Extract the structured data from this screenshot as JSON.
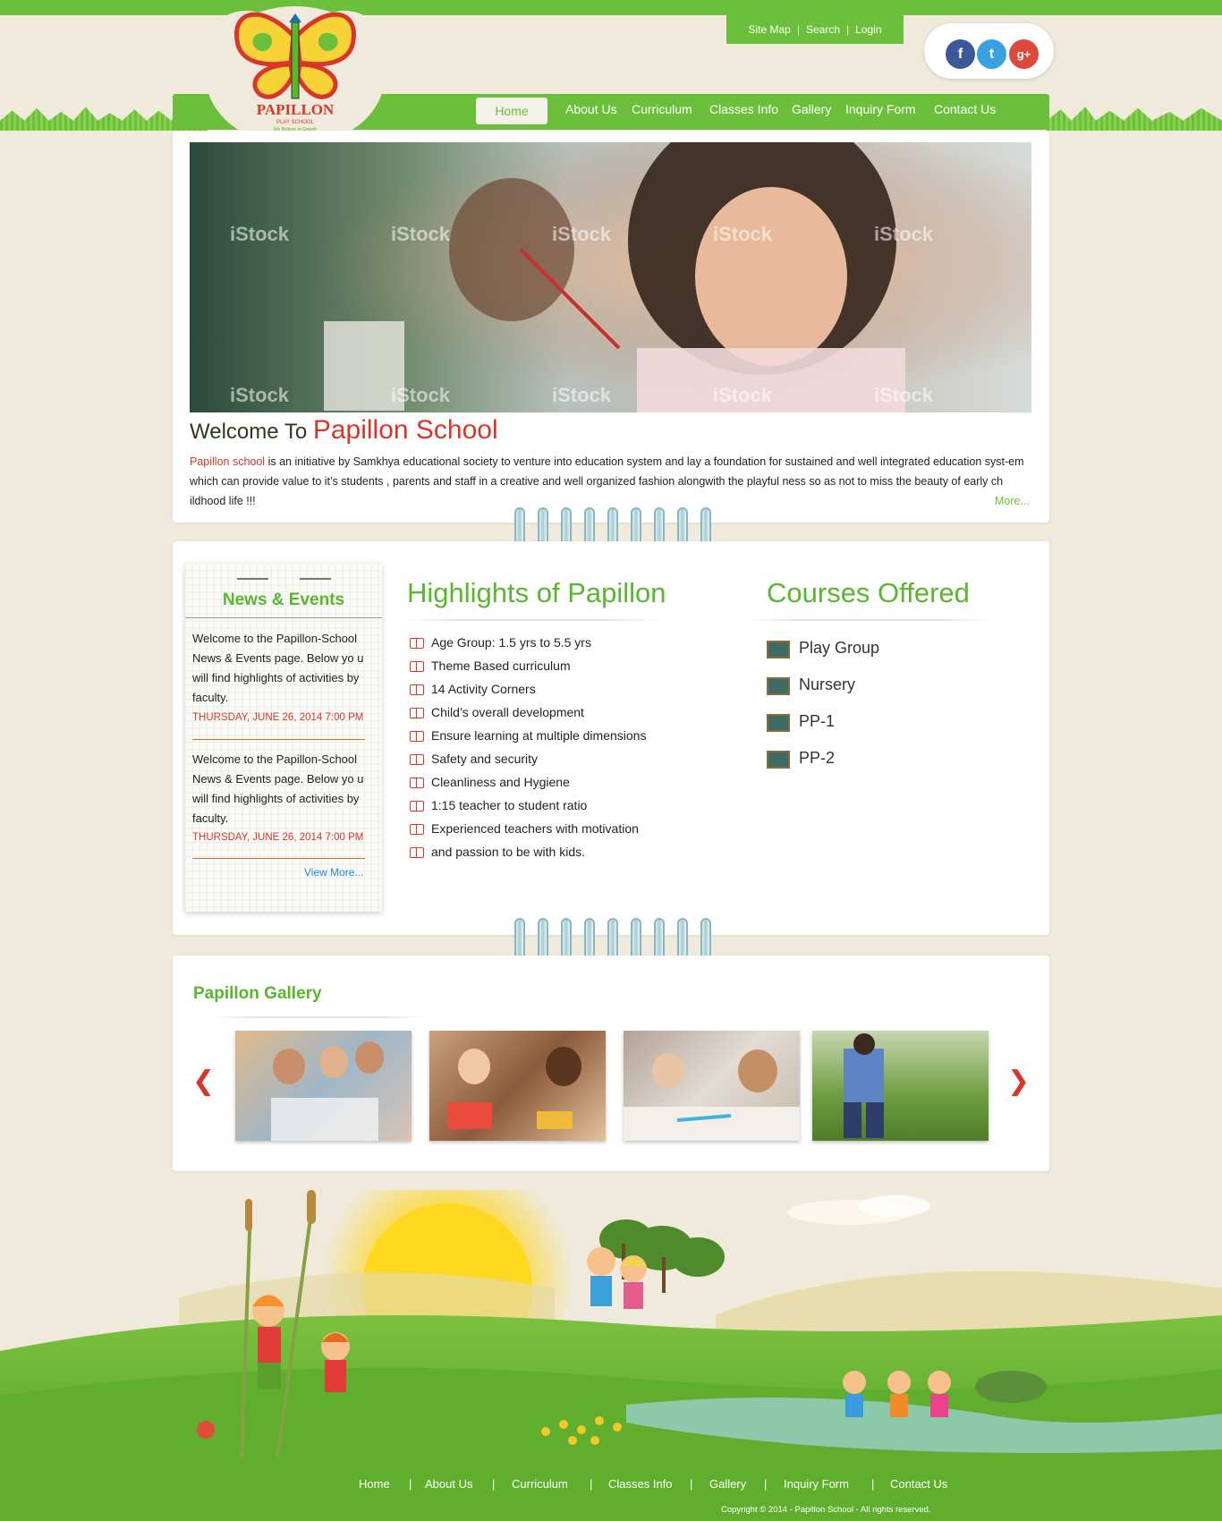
{
  "header": {
    "logo": {
      "name": "PAPILLON",
      "sub": "PLAY SCHOOL",
      "tagline": "We Believe In Growth"
    },
    "utility_links": [
      "Site Map",
      "Search",
      "Login"
    ],
    "social": [
      {
        "name": "facebook-icon",
        "glyph": "f",
        "color": "#3b5998"
      },
      {
        "name": "twitter-icon",
        "glyph": "t",
        "color": "#3aa1e0"
      },
      {
        "name": "google-plus-icon",
        "glyph": "g+",
        "color": "#dc4a3d"
      }
    ],
    "nav": [
      "Home",
      "About Us",
      "Curriculum",
      "Classes Info",
      "Gallery",
      "Inquiry Form",
      "Contact Us"
    ],
    "active_nav": "Home"
  },
  "welcome": {
    "title_prefix": "Welcome To",
    "title_name": "Papillon School",
    "lead": "Papillon school",
    "body": " is an initiative by Samkhya educational society  to venture into education system and lay a foundation for sustained and well integrated education syst-em which can provide value to it’s students , parents and staff in a creative and well organized fashion alongwith the playful ness so as not to miss the beauty of early ch ildhood life !!!",
    "more": "More..."
  },
  "news": {
    "title": "News & Events",
    "items": [
      {
        "text": "Welcome to the Papillon-School News & Events page.  Below yo u will find highlights of activities by faculty.",
        "date": "THURSDAY, JUNE 26, 2014 7:00 PM"
      },
      {
        "text": "Welcome to the Papillon-School News & Events page.  Below yo u will find highlights of activities by faculty.",
        "date": "THURSDAY, JUNE 26, 2014 7:00 PM"
      }
    ],
    "view_more": "View More..."
  },
  "highlights": {
    "title": "Highlights of Papillon",
    "items": [
      "Age Group: 1.5 yrs to 5.5 yrs",
      "Theme Based curriculum",
      "14 Activity Corners",
      "Child’s overall development",
      "Ensure learning at multiple dimensions",
      "Safety and security",
      "Cleanliness and Hygiene",
      "1:15 teacher to student ratio",
      "Experienced teachers with motivation",
      "and passion to be with kids."
    ]
  },
  "courses": {
    "title": "Courses Offered",
    "items": [
      "Play Group",
      "Nursery",
      "PP-1",
      "PP-2"
    ]
  },
  "gallery": {
    "title": "Papillon Gallery",
    "prev": "❮",
    "next": "❯",
    "watermark": "iStock"
  },
  "footer": {
    "nav": [
      "Home",
      "About Us",
      "Curriculum",
      "Classes Info",
      "Gallery",
      "Inquiry Form",
      "Contact Us"
    ],
    "separator": "|",
    "copyright": "Copyright © 2014 - Papillon School - All rights reserved."
  }
}
